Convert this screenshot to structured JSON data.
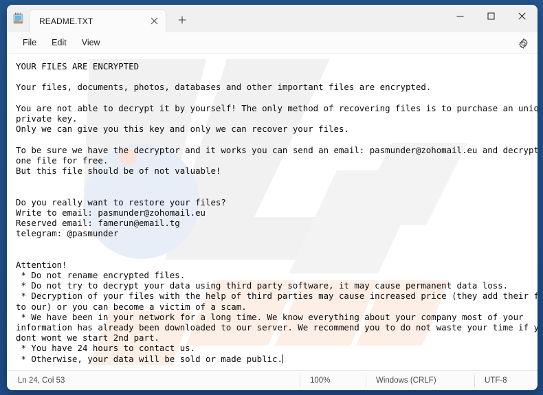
{
  "window": {
    "app_icon": "notepad-icon",
    "controls": {
      "minimize": "minimize-icon",
      "maximize": "maximize-icon",
      "close": "close-icon"
    }
  },
  "tabs": [
    {
      "title": "README.TXT",
      "close_label": "close-tab-icon",
      "active": true
    }
  ],
  "new_tab_label": "new-tab-icon",
  "menubar": {
    "items": [
      {
        "label": "File"
      },
      {
        "label": "Edit"
      },
      {
        "label": "View"
      }
    ],
    "settings_label": "gear-icon"
  },
  "document": {
    "text": "YOUR FILES ARE ENCRYPTED\n\nYour files, documents, photos, databases and other important files are encrypted.\n\nYou are not able to decrypt it by yourself! The only method of recovering files is to purchase an unique\nprivate key.\nOnly we can give you this key and only we can recover your files.\n\nTo be sure we have the decryptor and it works you can send an email: pasmunder@zohomail.eu and decrypt\none file for free.\nBut this file should be of not valuable!\n\n\nDo you really want to restore your files?\nWrite to email: pasmunder@zohomail.eu\nReserved email: famerun@email.tg\ntelegram: @pasmunder\n\n\nAttention!\n * Do not rename encrypted files.\n * Do not try to decrypt your data using third party software, it may cause permanent data loss.\n * Decryption of your files with the help of third parties may cause increased price (they add their fee\nto our) or you can become a victim of a scam.\n * We have been in your network for a long time. We know everything about your company most of your\ninformation has already been downloaded to our server. We recommend you to do not waste your time if you\ndont wont we start 2nd part.\n * You have 24 hours to contact us.\n * Otherwise, your data will be sold or made public.",
    "contact": {
      "primary_email": "pasmunder@zohomail.eu",
      "reserved_email": "famerun@email.tg",
      "telegram": "@pasmunder",
      "deadline": "24 hours"
    }
  },
  "statusbar": {
    "position": "Ln 24, Col 53",
    "zoom": "100%",
    "line_ending": "Windows (CRLF)",
    "encoding": "UTF-8"
  },
  "colors": {
    "desktop": "#21538f",
    "window": "#fbfbfb",
    "editor": "#ffffff",
    "text": "#0a0a0a",
    "titlebar": "#f0f0f0",
    "status_text": "#4a4a4a"
  }
}
